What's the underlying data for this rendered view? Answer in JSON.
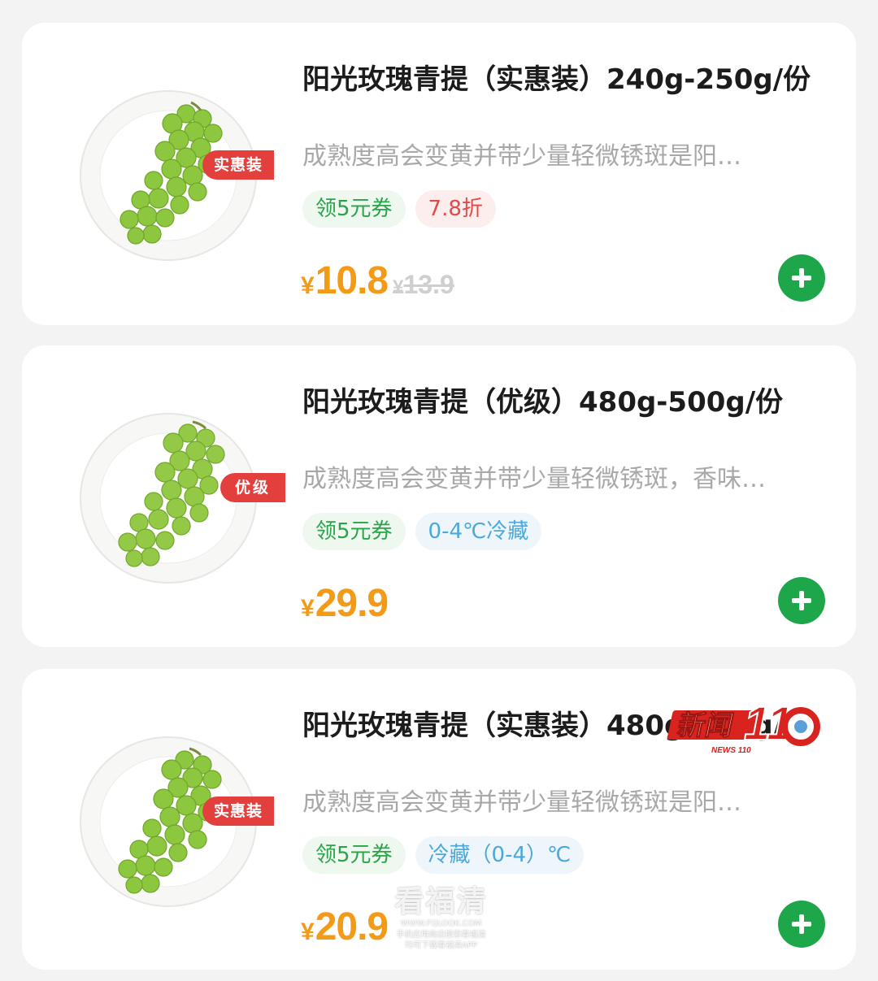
{
  "colors": {
    "price": "#f39a16",
    "tag": "#e3403d",
    "add_button": "#1ea64b",
    "coupon_chip": "#2aa34a",
    "discount_chip": "#e24a4a",
    "storage_chip": "#4aa9da"
  },
  "products": [
    {
      "title": "阳光玫瑰青提（实惠装）240g-250g/份",
      "description": "成熟度高会变黄并带少量轻微锈斑是阳…",
      "tag": "实惠装",
      "chips": [
        "领5元券",
        "7.8折"
      ],
      "currency": "¥",
      "price": "10.8",
      "original_price": "13.9"
    },
    {
      "title": "阳光玫瑰青提（优级）480g-500g/份",
      "description": "成熟度高会变黄并带少量轻微锈斑，香味…",
      "tag": "优级",
      "chips": [
        "领5元券",
        "0-4℃冷藏"
      ],
      "currency": "¥",
      "price": "29.9"
    },
    {
      "title": "阳光玫瑰青提（实惠装）480g-500g/份",
      "description": "成熟度高会变黄并带少量轻微锈斑是阳…",
      "tag": "实惠装",
      "chips": [
        "领5元券",
        "冷藏（0-4）℃"
      ],
      "currency": "¥",
      "price": "20.9"
    }
  ],
  "overlays": {
    "news_logo_text": "新闻110",
    "news_logo_subtext": "NEWS 110",
    "watermark_title": "看福清",
    "watermark_url": "WWW.FQLOOK.COM",
    "watermark_line1": "手机应用商店搜索看福清",
    "watermark_line2": "均可下载看福清APP"
  }
}
